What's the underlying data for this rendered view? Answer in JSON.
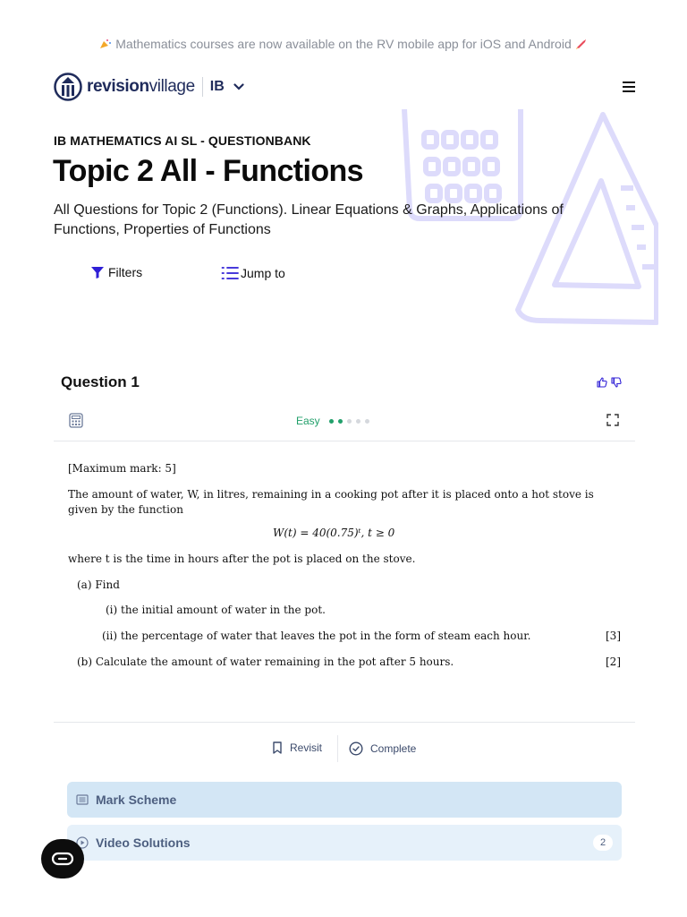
{
  "announcement": {
    "text": "Mathematics courses are now available on the RV mobile app for iOS and Android",
    "icon_left": "party-popper-icon",
    "icon_right": "rocket-icon"
  },
  "header": {
    "logo_bold": "revision",
    "logo_light": "village",
    "program": "IB",
    "menu_icon": "hamburger-icon"
  },
  "page": {
    "kicker": "IB MATHEMATICS AI SL - QUESTIONBANK",
    "title": "Topic 2 All - Functions",
    "description": "All Questions for Topic 2 (Functions). Linear Equations & Graphs, Applications of Functions, Properties of Functions",
    "filters_label": "Filters",
    "jump_label": "Jump to"
  },
  "question": {
    "title": "Question 1",
    "difficulty": "Easy",
    "difficulty_level": 2,
    "difficulty_max": 5,
    "max_mark": "[Maximum mark: 5]",
    "intro": "The amount of water, W, in litres, remaining in a cooking pot after it is placed onto a hot stove is given by the function",
    "formula": "W(t) = 40(0.75)ᵗ,    t ≥ 0",
    "where": "where t is the time in hours after the pot is placed on the stove.",
    "part_a": "(a) Find",
    "part_a_i": "(i) the initial amount of water in the pot.",
    "part_a_ii": "(ii) the percentage of water that leaves the pot in the form of steam each hour.",
    "part_a_marks": "[3]",
    "part_b": "(b) Calculate the amount of water remaining in the pot after 5 hours.",
    "part_b_marks": "[2]"
  },
  "actions": {
    "revisit": "Revisit",
    "complete": "Complete"
  },
  "panels": {
    "mark_scheme": "Mark Scheme",
    "video_solutions": "Video Solutions",
    "video_count": "2"
  },
  "colors": {
    "brand": "#1f2b5b",
    "accent_blue": "#2f1fd6",
    "easy_green": "#22a06b",
    "panel_blue": "#d3e6f5",
    "panel_blue_light": "#e6f1fa"
  }
}
